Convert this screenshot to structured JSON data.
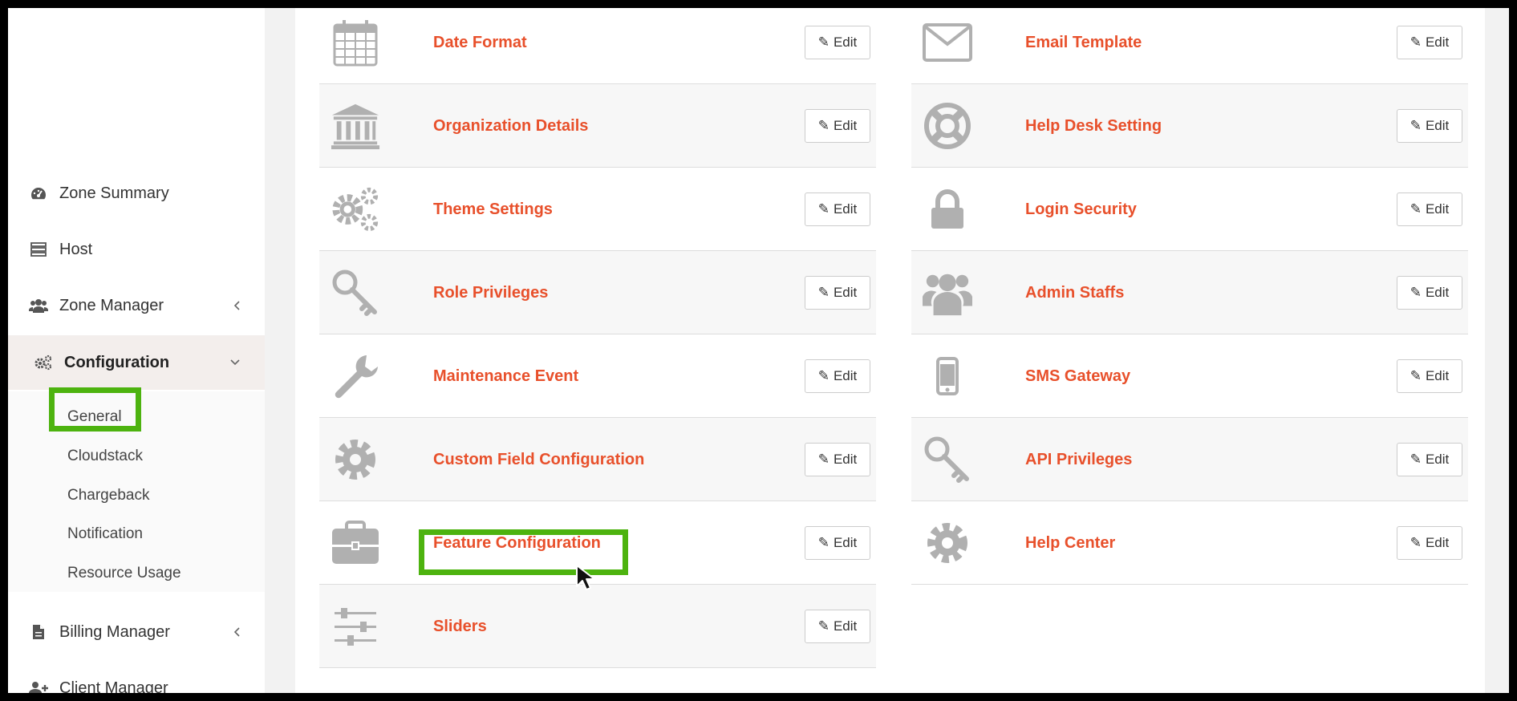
{
  "sidebar": {
    "items": [
      {
        "label": "Zone Summary",
        "icon": "dashboard-icon"
      },
      {
        "label": "Host",
        "icon": "server-icon"
      },
      {
        "label": "Zone Manager",
        "icon": "users-icon",
        "chevron": "‹"
      },
      {
        "label": "Configuration",
        "icon": "gears-icon",
        "chevron": "⌄"
      }
    ],
    "submenu": [
      "General",
      "Cloudstack",
      "Chargeback",
      "Notification",
      "Resource Usage"
    ],
    "items_bottom": [
      {
        "label": "Billing Manager",
        "icon": "document-icon",
        "chevron": "‹"
      },
      {
        "label": "Client Manager",
        "icon": "user-plus-icon"
      }
    ]
  },
  "edit_label": "Edit",
  "left_settings": [
    {
      "title": "Date Format",
      "icon": "calendar-icon"
    },
    {
      "title": "Organization Details",
      "icon": "bank-icon"
    },
    {
      "title": "Theme Settings",
      "icon": "gears-icon"
    },
    {
      "title": "Role Privileges",
      "icon": "key-icon"
    },
    {
      "title": "Maintenance Event",
      "icon": "wrench-icon"
    },
    {
      "title": "Custom Field Configuration",
      "icon": "gear-icon"
    },
    {
      "title": "Feature Configuration",
      "icon": "briefcase-icon"
    },
    {
      "title": "Sliders",
      "icon": "sliders-icon"
    }
  ],
  "right_settings": [
    {
      "title": "Email Template",
      "icon": "envelope-icon"
    },
    {
      "title": "Help Desk Setting",
      "icon": "life-ring-icon"
    },
    {
      "title": "Login Security",
      "icon": "lock-icon"
    },
    {
      "title": "Admin Staffs",
      "icon": "users-icon"
    },
    {
      "title": "SMS Gateway",
      "icon": "mobile-icon"
    },
    {
      "title": "API Privileges",
      "icon": "key-icon"
    },
    {
      "title": "Help Center",
      "icon": "gear-icon"
    }
  ],
  "colors": {
    "accent": "#e8502b",
    "highlight": "#4db30f",
    "icon": "#b0b0b0"
  }
}
